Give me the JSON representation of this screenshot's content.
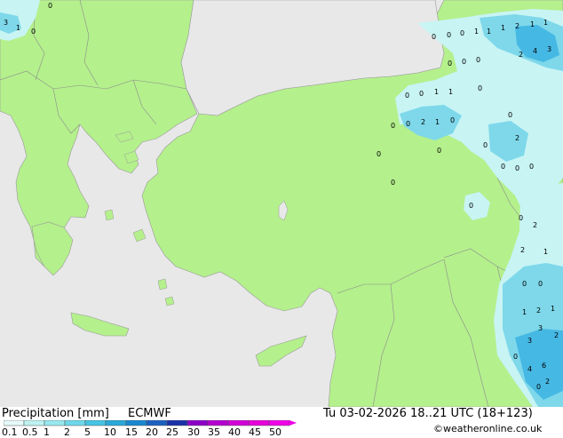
{
  "header": {
    "title": "Precipitation [mm]",
    "model": "ECMWF",
    "datetime": "Tu 03-02-2026 18..21 UTC (18+123)",
    "credit": "©weatheronline.co.uk"
  },
  "legend": {
    "labels": [
      "0.1",
      "0.5",
      "1",
      "2",
      "5",
      "10",
      "15",
      "20",
      "25",
      "30",
      "35",
      "40",
      "45",
      "50"
    ],
    "colors": [
      "#e6fafa",
      "#bdf2f2",
      "#96e8ee",
      "#6ed8ea",
      "#46c4e4",
      "#2aa8da",
      "#1a88d0",
      "#1a60c0",
      "#1a30a8",
      "#8c00c8",
      "#b400d0",
      "#d200d8",
      "#e800dc",
      "#f000e8"
    ]
  },
  "colors": {
    "land": "#b4f08c",
    "sea": "#e8e8e8",
    "precip_light": "#c8f4f4",
    "precip_medium": "#7ed8ea",
    "precip_heavy": "#46b8e4"
  },
  "precip_values": [
    {
      "t": "3"
    },
    {
      "t": "1"
    },
    {
      "t": "0"
    },
    {
      "t": "0"
    },
    {
      "t": "0"
    },
    {
      "t": "0"
    },
    {
      "t": "0"
    },
    {
      "t": "1"
    },
    {
      "t": "1"
    },
    {
      "t": "1"
    },
    {
      "t": "2"
    },
    {
      "t": "1"
    },
    {
      "t": "1"
    },
    {
      "t": "0"
    },
    {
      "t": "0"
    },
    {
      "t": "0"
    },
    {
      "t": "2"
    },
    {
      "t": "4"
    },
    {
      "t": "3"
    },
    {
      "t": "0"
    },
    {
      "t": "0"
    },
    {
      "t": "1"
    },
    {
      "t": "1"
    },
    {
      "t": "0"
    },
    {
      "t": "0"
    },
    {
      "t": "0"
    },
    {
      "t": "2"
    },
    {
      "t": "1"
    },
    {
      "t": "0"
    },
    {
      "t": "0"
    },
    {
      "t": "0"
    },
    {
      "t": "2"
    },
    {
      "t": "0"
    },
    {
      "t": "0"
    },
    {
      "t": "0"
    },
    {
      "t": "0"
    },
    {
      "t": "0"
    },
    {
      "t": "0"
    },
    {
      "t": "0"
    },
    {
      "t": "0"
    },
    {
      "t": "2"
    },
    {
      "t": "1"
    },
    {
      "t": "2"
    },
    {
      "t": "0"
    },
    {
      "t": "0"
    },
    {
      "t": "1"
    },
    {
      "t": "2"
    },
    {
      "t": "1"
    },
    {
      "t": "3"
    },
    {
      "t": "3"
    },
    {
      "t": "2"
    },
    {
      "t": "0"
    },
    {
      "t": "6"
    },
    {
      "t": "4"
    },
    {
      "t": "2"
    },
    {
      "t": "0"
    }
  ]
}
